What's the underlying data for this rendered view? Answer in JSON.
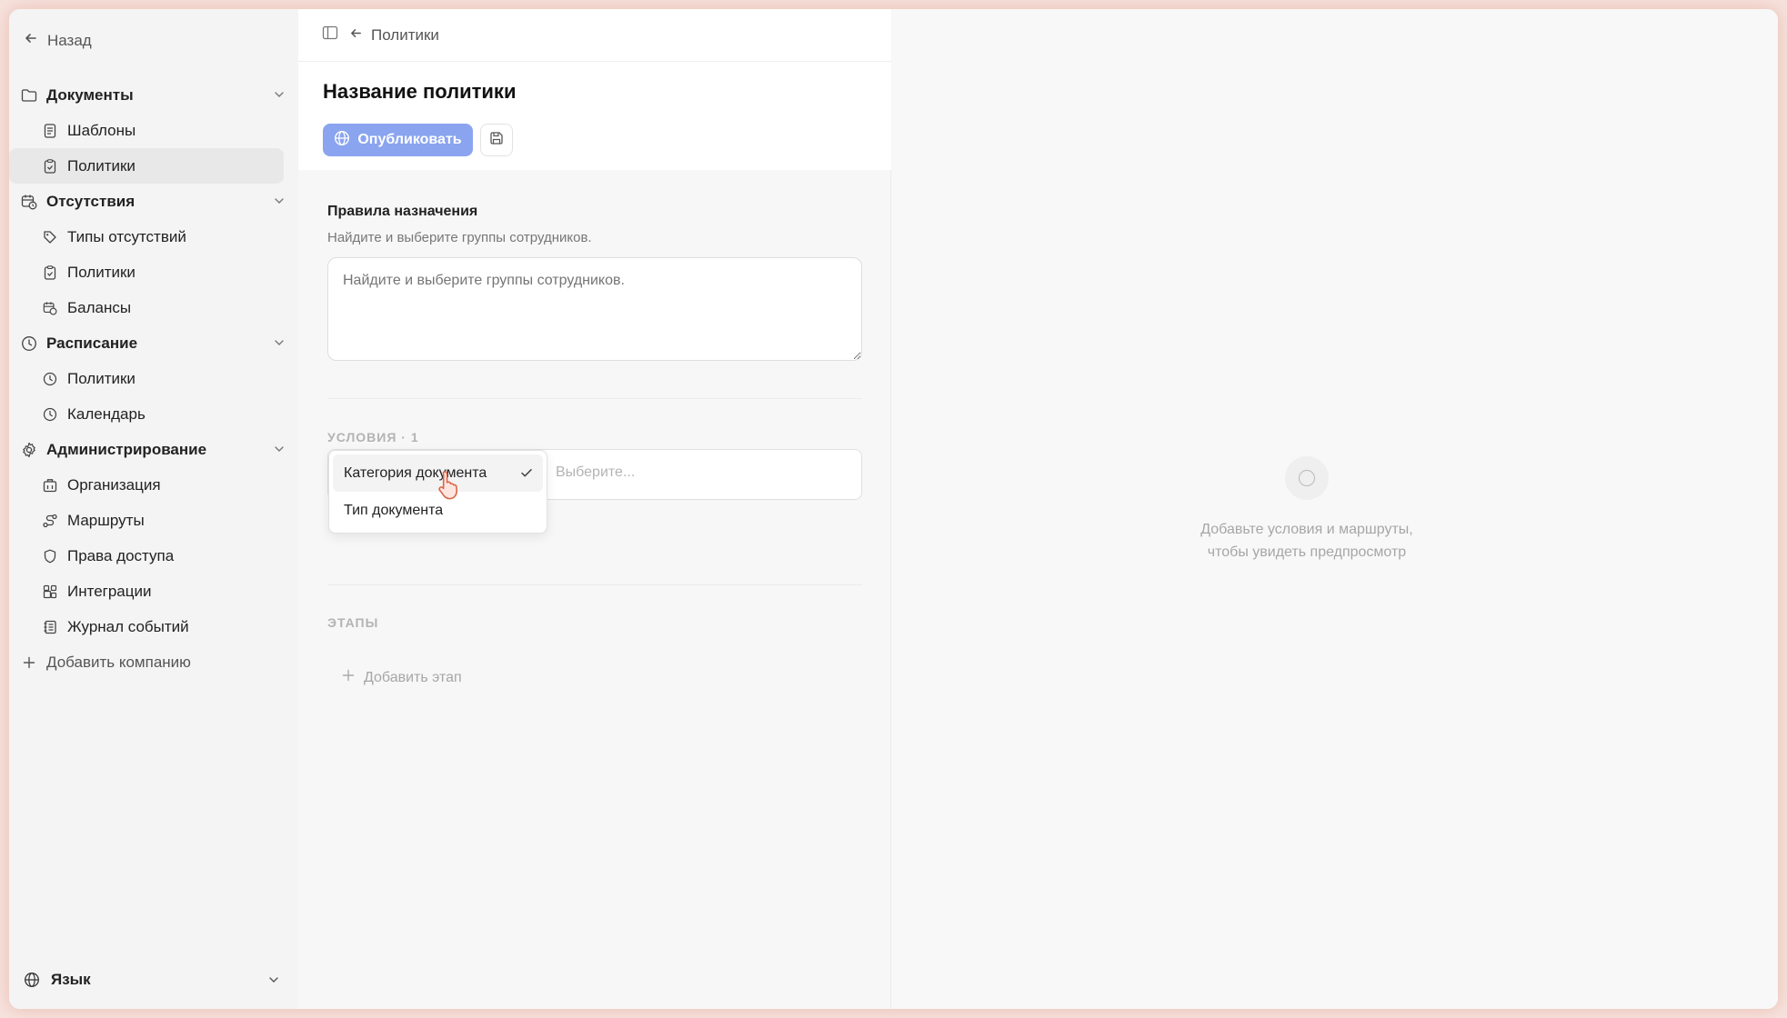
{
  "sidebar": {
    "back_label": "Назад",
    "groups": [
      {
        "label": "Документы",
        "icon": "folder-icon",
        "items": [
          {
            "label": "Шаблоны",
            "icon": "document-icon",
            "active": false
          },
          {
            "label": "Политики",
            "icon": "clipboard-check-icon",
            "active": true
          }
        ]
      },
      {
        "label": "Отсутствия",
        "icon": "calendar-clock-icon",
        "items": [
          {
            "label": "Типы отсутствий",
            "icon": "tags-icon",
            "active": false
          },
          {
            "label": "Политики",
            "icon": "clipboard-check-icon",
            "active": false
          },
          {
            "label": "Балансы",
            "icon": "calendar-clock-icon",
            "active": false
          }
        ]
      },
      {
        "label": "Расписание",
        "icon": "clock-icon",
        "items": [
          {
            "label": "Политики",
            "icon": "clock-icon",
            "active": false
          },
          {
            "label": "Календарь",
            "icon": "clock-icon",
            "active": false
          }
        ]
      },
      {
        "label": "Администрирование",
        "icon": "gear-icon",
        "items": [
          {
            "label": "Организация",
            "icon": "building-icon",
            "active": false
          },
          {
            "label": "Маршруты",
            "icon": "route-icon",
            "active": false
          },
          {
            "label": "Права доступа",
            "icon": "shield-icon",
            "active": false
          },
          {
            "label": "Интеграции",
            "icon": "blocks-icon",
            "active": false
          },
          {
            "label": "Журнал событий",
            "icon": "log-icon",
            "active": false
          }
        ]
      }
    ],
    "add_company_label": "Добавить компанию",
    "language_label": "Язык"
  },
  "editor": {
    "breadcrumb": "Политики",
    "title": "Название политики",
    "publish_label": "Опубликовать",
    "assignment": {
      "title": "Правила назначения",
      "description": "Найдите и выберите группы сотрудников.",
      "placeholder": "Найдите и выберите группы сотрудников."
    },
    "conditions": {
      "heading": "УСЛОВИЯ · 1",
      "value_placeholder": "Выберите...",
      "options": [
        {
          "label": "Категория документа",
          "selected": true
        },
        {
          "label": "Тип документа",
          "selected": false
        }
      ]
    },
    "stages": {
      "heading": "ЭТАПЫ",
      "add_label": "Добавить этап"
    }
  },
  "preview": {
    "line1": "Добавьте условия и маршруты,",
    "line2": "чтобы увидеть предпросмотр"
  },
  "colors": {
    "accent": "#8aa4f0",
    "frame_glow": "#f7e2dd",
    "active_bg": "#e8e8e8"
  }
}
